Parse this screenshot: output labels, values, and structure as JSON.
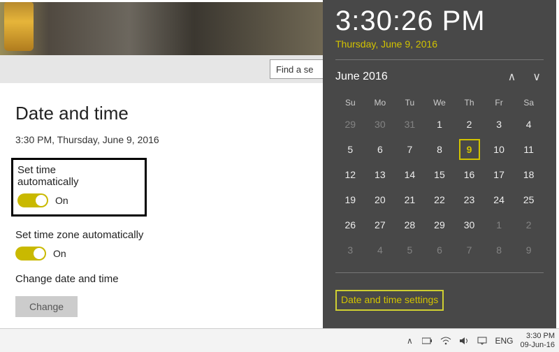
{
  "settings": {
    "title": "Date and time",
    "now_line": "3:30 PM, Thursday, June 9, 2016",
    "search_placeholder": "Find a se",
    "set_time_auto": {
      "label": "Set time automatically",
      "state": "On"
    },
    "set_tz_auto": {
      "label": "Set time zone automatically",
      "state": "On"
    },
    "change_section_label": "Change date and time",
    "change_button": "Change"
  },
  "flyout": {
    "time": "3:30:26 PM",
    "date": "Thursday, June 9, 2016",
    "month_label": "June 2016",
    "settings_link": "Date and time settings",
    "dow": [
      "Su",
      "Mo",
      "Tu",
      "We",
      "Th",
      "Fr",
      "Sa"
    ],
    "weeks": [
      [
        {
          "n": 29,
          "dim": true
        },
        {
          "n": 30,
          "dim": true
        },
        {
          "n": 31,
          "dim": true
        },
        {
          "n": 1
        },
        {
          "n": 2
        },
        {
          "n": 3
        },
        {
          "n": 4
        }
      ],
      [
        {
          "n": 5
        },
        {
          "n": 6
        },
        {
          "n": 7
        },
        {
          "n": 8
        },
        {
          "n": 9,
          "today": true
        },
        {
          "n": 10
        },
        {
          "n": 11
        }
      ],
      [
        {
          "n": 12
        },
        {
          "n": 13
        },
        {
          "n": 14
        },
        {
          "n": 15
        },
        {
          "n": 16
        },
        {
          "n": 17
        },
        {
          "n": 18
        }
      ],
      [
        {
          "n": 19
        },
        {
          "n": 20
        },
        {
          "n": 21
        },
        {
          "n": 22
        },
        {
          "n": 23
        },
        {
          "n": 24
        },
        {
          "n": 25
        }
      ],
      [
        {
          "n": 26
        },
        {
          "n": 27
        },
        {
          "n": 28
        },
        {
          "n": 29
        },
        {
          "n": 30
        },
        {
          "n": 1,
          "dim": true
        },
        {
          "n": 2,
          "dim": true
        }
      ],
      [
        {
          "n": 3,
          "dim": true
        },
        {
          "n": 4,
          "dim": true
        },
        {
          "n": 5,
          "dim": true
        },
        {
          "n": 6,
          "dim": true
        },
        {
          "n": 7,
          "dim": true
        },
        {
          "n": 8,
          "dim": true
        },
        {
          "n": 9,
          "dim": true
        }
      ]
    ]
  },
  "icons": {
    "wifi": "wifi-icon",
    "power": "power-icon",
    "volume": "volume-icon",
    "action": "action-center-icon",
    "tray_up": "tray-chevron-icon"
  },
  "taskbar": {
    "lang": "ENG",
    "clock_time": "3:30 PM",
    "clock_date": "09-Jun-16"
  }
}
